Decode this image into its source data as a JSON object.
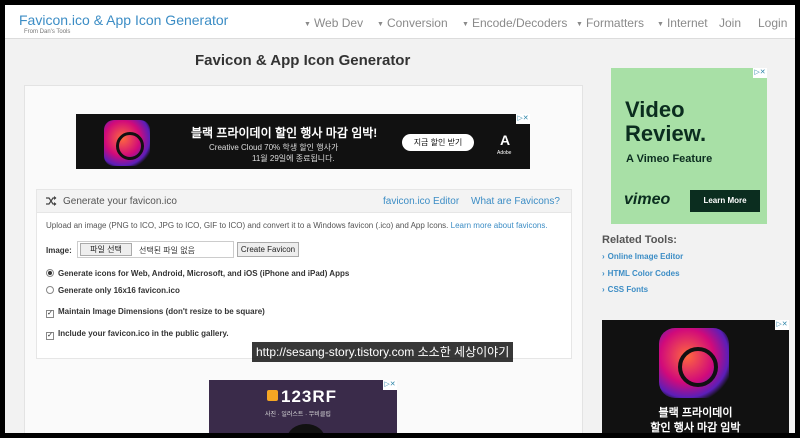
{
  "brand": {
    "title": "Favicon.ico & App Icon Generator",
    "subtitle": "From Dan's Tools"
  },
  "nav": {
    "items": [
      {
        "label": "Web Dev",
        "dropdown": true
      },
      {
        "label": "Conversion",
        "dropdown": true
      },
      {
        "label": "Encode/Decoders",
        "dropdown": true
      },
      {
        "label": "Formatters",
        "dropdown": true
      },
      {
        "label": "Internet",
        "dropdown": true
      },
      {
        "label": "Join",
        "dropdown": false
      },
      {
        "label": "Login",
        "dropdown": false
      }
    ]
  },
  "page": {
    "title": "Favicon & App Icon Generator"
  },
  "top_ad": {
    "headline": "블랙 프라이데이 할인 행사 마감 임박!",
    "line1": "Creative Cloud 70% 학생 할인 행사가",
    "line2": "11월 29일에 종료됩니다.",
    "cta": "지금 할인 받기",
    "brand": "Adobe"
  },
  "generator": {
    "title": "Generate your favicon.ico",
    "links": [
      "favicon.ico Editor",
      "What are Favicons?"
    ],
    "description": "Upload an image (PNG to ICO, JPG to ICO, GIF to ICO) and convert it to a Windows favicon (.ico) and App Icons.",
    "learn_more": "Learn more about favicons.",
    "image_label": "Image:",
    "file_button": "파일 선택",
    "file_status": "선택된 파일 없음",
    "create_button": "Create Favicon",
    "options": [
      {
        "type": "radio",
        "checked": true,
        "label": "Generate icons for Web, Android, Microsoft, and iOS (iPhone and iPad) Apps"
      },
      {
        "type": "radio",
        "checked": false,
        "label": "Generate only 16x16 favicon.ico"
      },
      {
        "type": "checkbox",
        "checked": true,
        "label": "Maintain Image Dimensions (don't resize to be square)"
      },
      {
        "type": "checkbox",
        "checked": true,
        "label": "Include your favicon.ico in the public gallery."
      }
    ]
  },
  "bottom_ad": {
    "brand": "123RF",
    "tagline": "사진 · 일러스트 · 무비클립"
  },
  "sidebar": {
    "ad": {
      "headline": "Video Review.",
      "sub": "A Vimeo Feature",
      "brand": "vimeo",
      "cta": "Learn More"
    },
    "related_title": "Related Tools:",
    "related": [
      "Online Image Editor",
      "HTML Color Codes",
      "CSS Fonts"
    ],
    "ad2": {
      "line1": "블랙 프라이데이",
      "line2": "할인 행사 마감 임박"
    }
  },
  "watermark": "http://sesang-story.tistory.com 소소한 세상이야기",
  "colors": {
    "link": "#3c8dc5",
    "vimeo_bg": "#a8e0a6"
  }
}
